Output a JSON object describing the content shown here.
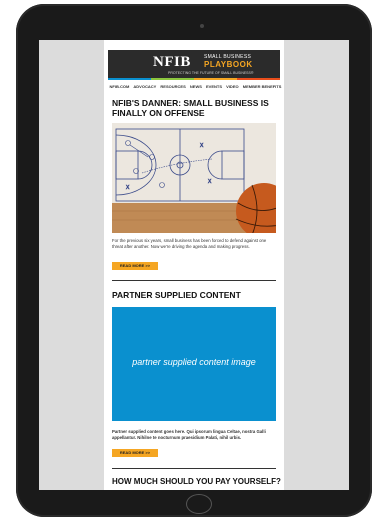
{
  "masthead": {
    "logo_main": "NFIB",
    "logo_small": "SMALL BUSINESS",
    "logo_playbook": "PLAYBOOK",
    "tagline": "PROTECTING THE FUTURE OF SMALL BUSINESS®"
  },
  "brand_colors": [
    "#0a90cf",
    "#8cc63f",
    "#f5a623",
    "#e94e1b"
  ],
  "nav": {
    "items": [
      "NFIB.COM",
      "ADVOCACY",
      "RESOURCES",
      "NEWS",
      "EVENTS",
      "VIDEO",
      "MEMBER BENEFITS"
    ]
  },
  "article1": {
    "title": "NFIB'S DANNER: SMALL BUSINESS IS FINALLY ON OFFENSE",
    "body": "For the previous six years, small business has been forced to defend against one threat after another. Now we're driving the agenda and making progress.",
    "button": "READ MORE >>"
  },
  "partner": {
    "heading": "PARTNER SUPPLIED CONTENT",
    "image_text": "partner supplied content image",
    "body": "Partner supplied content goes here. Qui ipsorum lingua Celtae, nostra Galli appellantur. Nihilne te nocturnum praesidium Palati, nihil urbis.",
    "button": "READ MORE >>"
  },
  "article3": {
    "title": "HOW MUCH SHOULD YOU PAY YOURSELF?"
  }
}
